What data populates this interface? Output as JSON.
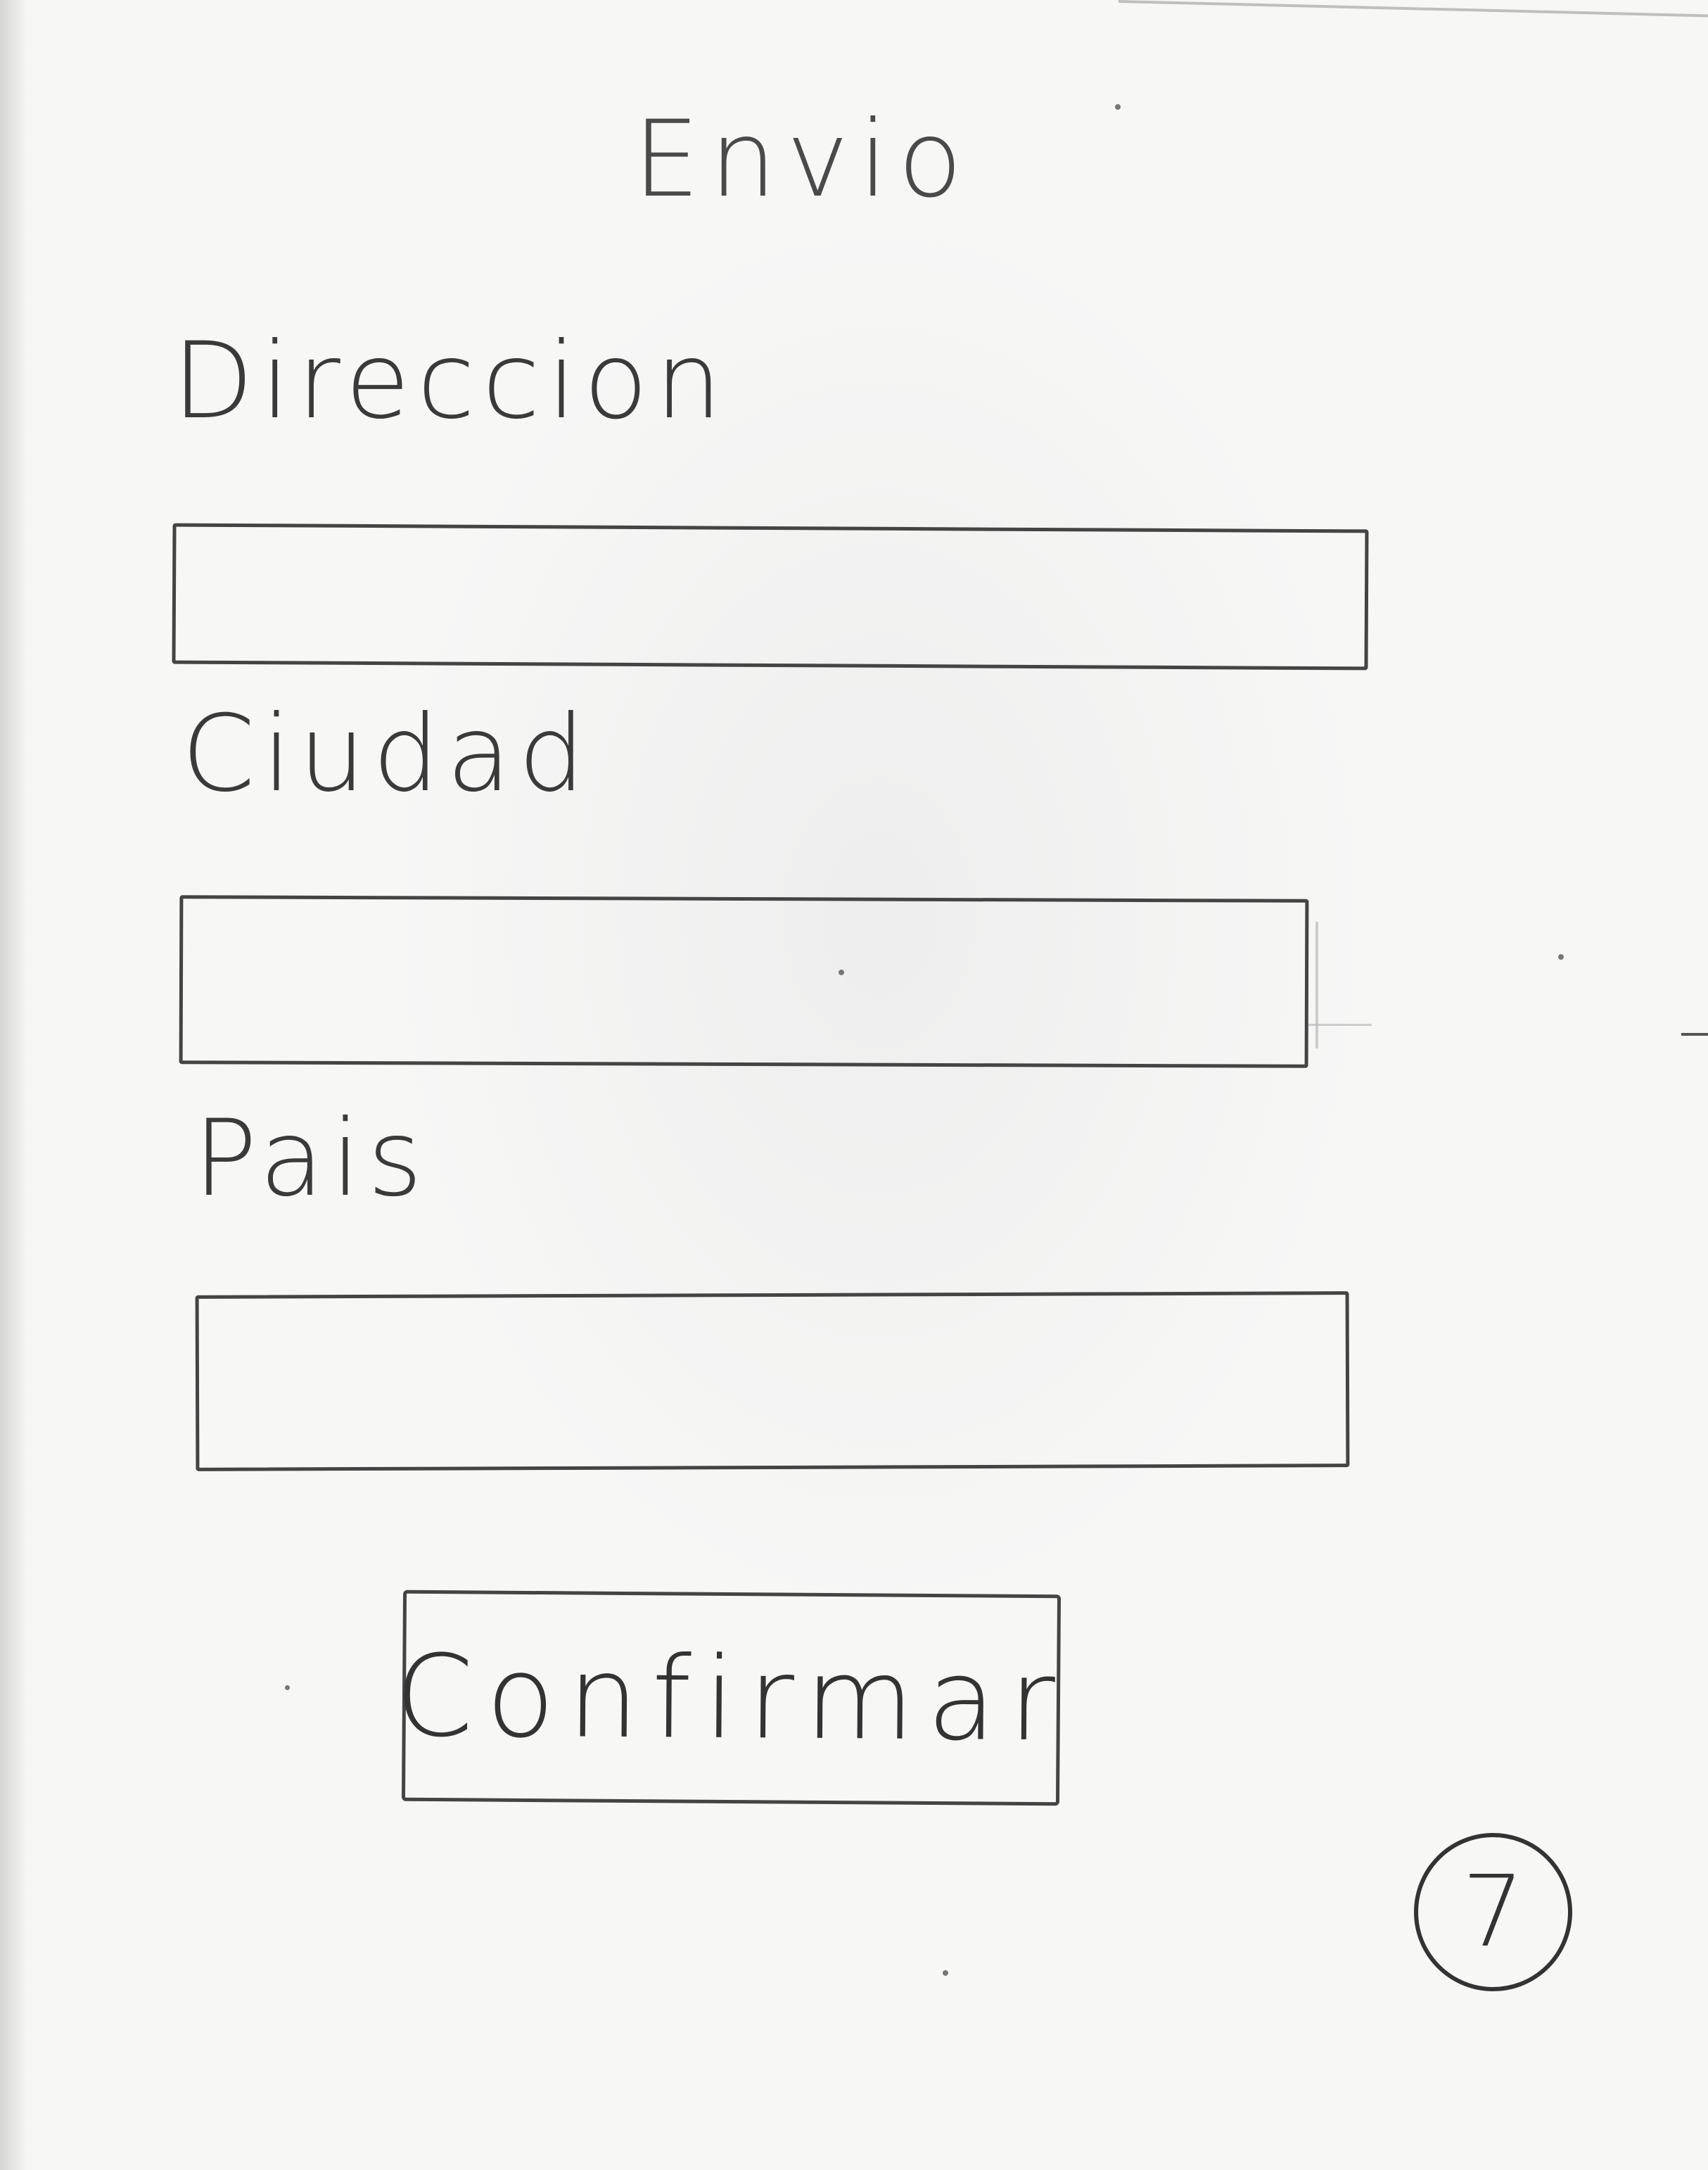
{
  "screen": {
    "title": "Envio"
  },
  "form": {
    "fields": [
      {
        "label": "Direccion",
        "value": ""
      },
      {
        "label": "Ciudad",
        "value": ""
      },
      {
        "label": "Pais",
        "value": ""
      }
    ],
    "submit_label": "Confirmar"
  },
  "page_number": "7"
}
